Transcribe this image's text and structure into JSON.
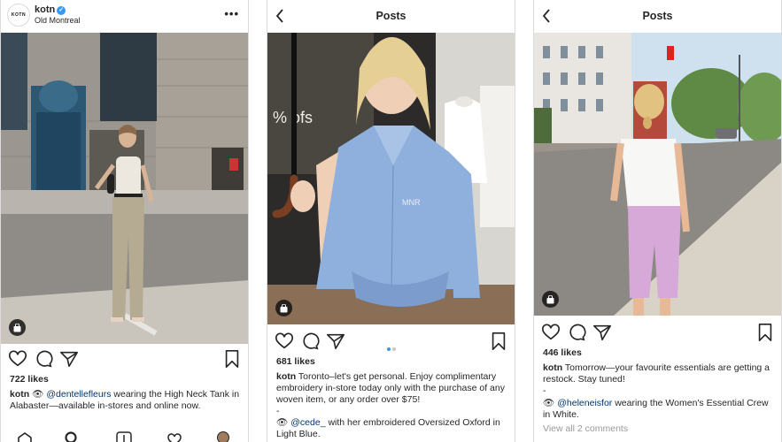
{
  "panel1": {
    "username": "kotn",
    "avatar_text": "KOTN",
    "location": "Old Montreal",
    "more_glyph": "•••",
    "likes": "722 likes",
    "caption_user": "kotn",
    "caption_emoji": "👁",
    "mention": "@dentellefleurs",
    "caption_text": "wearing the High Neck Tank in Alabaster—available in-stores and online now."
  },
  "panel2": {
    "header_title": "Posts",
    "likes": "681 likes",
    "caption_user": "kotn",
    "caption_text": "Toronto–let's get personal. Enjoy complimentary embroidery in-store today only with the purchase of any woven item, or any order over $75!",
    "dash": "-",
    "caption2_emoji": "👁",
    "mention": "@cede_",
    "caption2_text": "with her embroidered Oversized Oxford in Light Blue.",
    "shirt_embroidery": "MNR",
    "window_text": "% ofs",
    "carousel_active": 0,
    "carousel_count": 2
  },
  "panel3": {
    "header_title": "Posts",
    "likes": "446 likes",
    "caption_user": "kotn",
    "caption_text": "Tomorrow—your favourite essentials are getting a restock. Stay tuned!",
    "dash": "-",
    "caption2_emoji": "👁",
    "mention": "@heleneisfor",
    "caption2_text": "wearing the Women's Essential Crew in White.",
    "comments": "View all 2 comments"
  },
  "colors": {
    "verified": "#3897f0",
    "mention": "#003569",
    "muted": "#999999",
    "border": "#dbdbdb"
  },
  "icons": [
    "heart-icon",
    "comment-icon",
    "share-icon",
    "bookmark-icon",
    "shopping-bag-icon",
    "back-chevron-icon",
    "home-icon",
    "search-icon",
    "add-post-icon",
    "activity-icon"
  ]
}
